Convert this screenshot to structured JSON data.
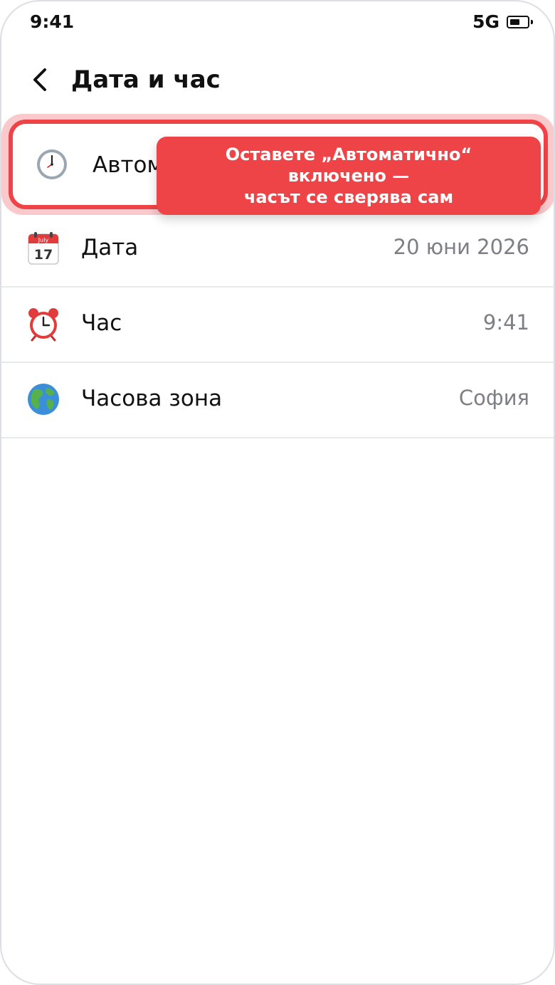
{
  "status_bar": {
    "time": "9:41",
    "network": "5G"
  },
  "header": {
    "title": "Дата и час"
  },
  "automatic_row": {
    "label": "Автоматично"
  },
  "tooltip": {
    "lines": [
      "Оставете „Автоматично“",
      "включено —",
      "часът се сверява сам"
    ]
  },
  "rows": [
    {
      "label": "Дата",
      "value": "20 юни 2026",
      "calendar_month": "July",
      "calendar_day": "17"
    },
    {
      "label": "Час",
      "value": "9:41"
    },
    {
      "label": "Часова зона",
      "value": "София"
    }
  ],
  "colors": {
    "accent": "#ef4447",
    "ring": "#f9c9cc",
    "value_text": "#7d7f84"
  }
}
